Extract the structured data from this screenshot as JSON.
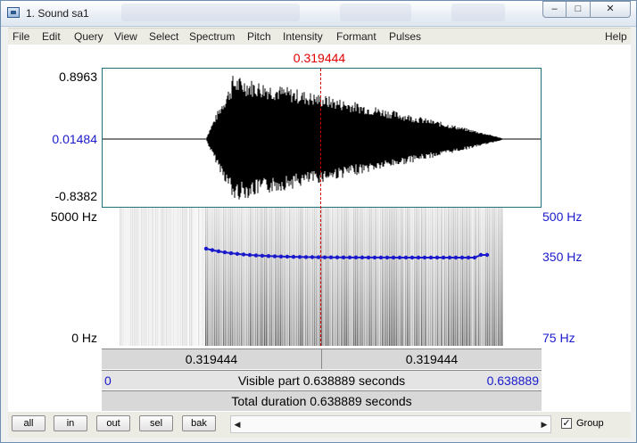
{
  "window": {
    "title": "1. Sound sa1",
    "min_glyph": "–",
    "max_glyph": "□",
    "close_glyph": "✕"
  },
  "menu": [
    "File",
    "Edit",
    "Query",
    "View",
    "Select",
    "Spectrum",
    "Pitch",
    "Intensity",
    "Formant",
    "Pulses",
    "Help"
  ],
  "cursor": {
    "time": "0.319444"
  },
  "waveform": {
    "max": "0.8963",
    "center": "0.01484",
    "min": "-0.8382"
  },
  "spectrogram": {
    "freq_top": "5000 Hz",
    "freq_bottom": "0 Hz"
  },
  "pitch": {
    "top": "500 Hz",
    "mid": "350 Hz",
    "bottom": "75 Hz"
  },
  "info": {
    "left_time": "0.319444",
    "right_time": "0.319444",
    "visible_start": "0",
    "visible_text": "Visible part 0.638889 seconds",
    "visible_end": "0.638889",
    "total_text": "Total duration 0.638889 seconds"
  },
  "toolbar": {
    "buttons": [
      "all",
      "in",
      "out",
      "sel",
      "bak"
    ],
    "group_label": "Group",
    "group_checked": true,
    "scroll_left": "◀",
    "scroll_right": "▶"
  }
}
